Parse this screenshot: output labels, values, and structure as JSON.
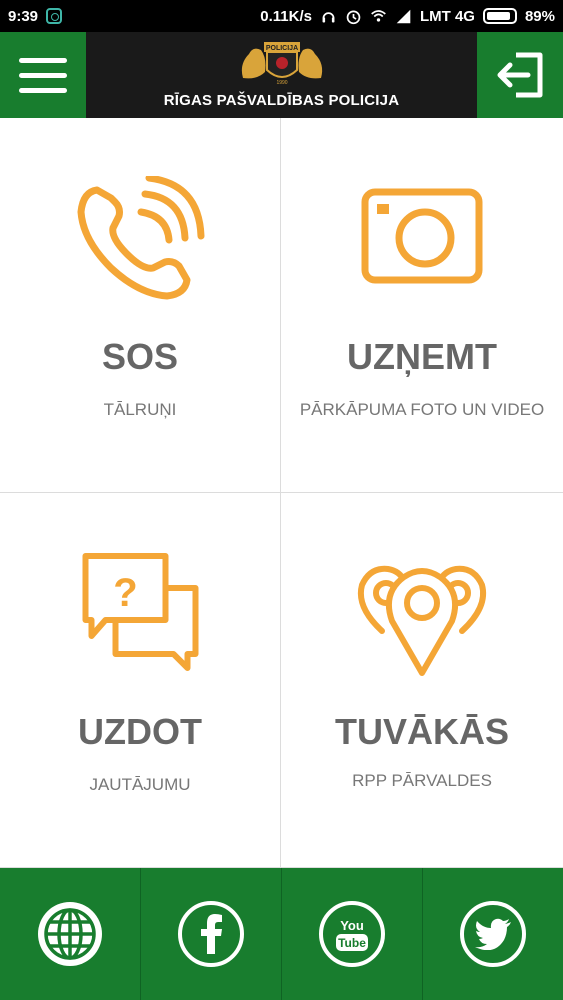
{
  "status_bar": {
    "time": "9:39",
    "speed": "0.11K/s",
    "carrier": "LMT 4G",
    "battery": "89%",
    "battery_level": 0.89
  },
  "header": {
    "title": "RĪGAS PAŠVALDĪBAS POLICIJA",
    "crest_text": "POLICIJA",
    "crest_year": "1990"
  },
  "tiles": [
    {
      "title": "SOS",
      "subtitle": "TĀLRUŅI",
      "icon": "phone-icon"
    },
    {
      "title": "UZŅEMT",
      "subtitle": "PĀRKĀPUMA FOTO UN VIDEO",
      "icon": "camera-icon"
    },
    {
      "title": "UZDOT",
      "subtitle": "JAUTĀJUMU",
      "icon": "chat-question-icon"
    },
    {
      "title": "TUVĀKĀS",
      "subtitle": "RPP PĀRVALDES",
      "icon": "location-pins-icon"
    }
  ],
  "footer": {
    "icons": [
      "globe-icon",
      "facebook-icon",
      "youtube-icon",
      "twitter-icon"
    ],
    "youtube_you": "You",
    "youtube_tube": "Tube"
  },
  "colors": {
    "brand_green": "#187d2e",
    "accent_orange": "#f4a636",
    "header_dark": "#1a1a1a"
  }
}
